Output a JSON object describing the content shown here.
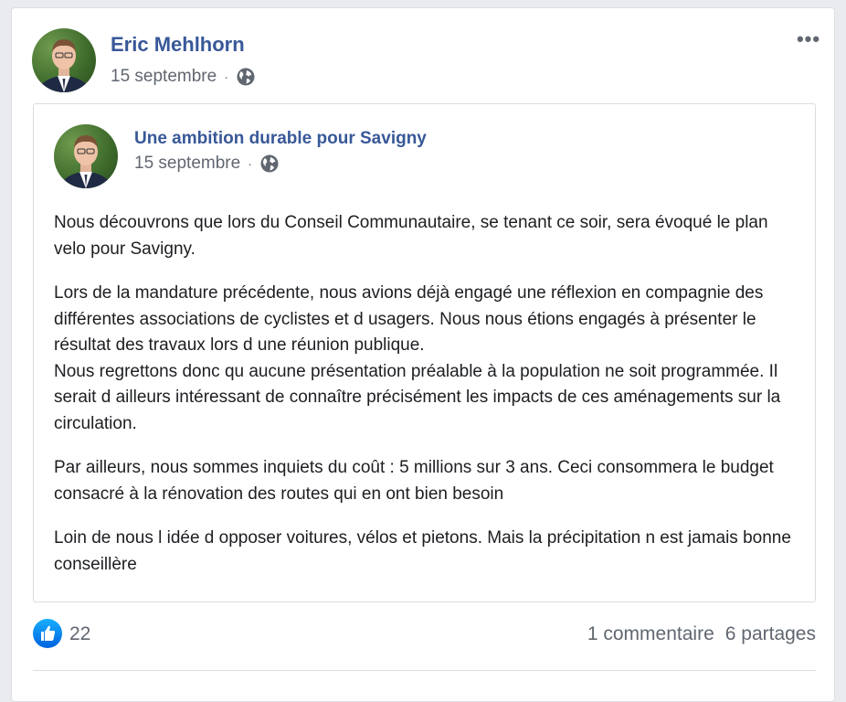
{
  "post": {
    "author_name": "Eric Mehlhorn",
    "date": "15 septembre",
    "separator": "·",
    "more_label": "•••"
  },
  "shared": {
    "page_name": "Une ambition durable pour Savigny",
    "date": "15 septembre",
    "separator": "·",
    "paragraphs": [
      "Nous découvrons que lors du Conseil Communautaire, se tenant ce soir, sera évoqué le plan velo pour Savigny.",
      "Lors de la mandature précédente, nous avions déjà engagé une réflexion en compagnie des différentes associations de cyclistes et d usagers. Nous nous étions engagés à présenter le résultat des travaux lors d une réunion publique.",
      "Nous regrettons donc qu aucune présentation préalable à la population ne soit programmée. Il serait d ailleurs intéressant de connaître précisément les impacts de ces aménagements sur la circulation.",
      "Par ailleurs, nous sommes inquiets du coût : 5 millions sur 3 ans. Ceci consommera le budget consacré à la rénovation des routes qui en ont bien besoin",
      "Loin de nous l idée d opposer voitures, vélos et pietons. Mais la précipitation n est jamais bonne conseillère"
    ]
  },
  "footer": {
    "like_count": "22",
    "comments": "1 commentaire",
    "shares": "6 partages"
  },
  "colors": {
    "link": "#385898",
    "meta": "#616770",
    "like_gradient_top": "#18afff",
    "like_gradient_bottom": "#0062df"
  },
  "icons": {
    "audience": "globe-icon",
    "reaction": "like-thumb-icon",
    "menu": "more-options-icon"
  }
}
